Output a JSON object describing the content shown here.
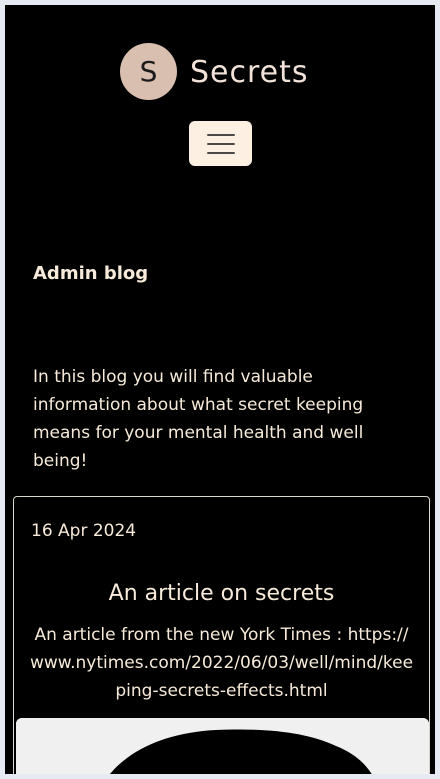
{
  "brand": {
    "logo_letter": "S",
    "name": "Secrets"
  },
  "nav": {
    "toggle_icon": "hamburger-menu-icon"
  },
  "page": {
    "title": "Admin blog",
    "intro": "In this blog you will find valuable information about what secret keeping means for your mental health and well being!"
  },
  "posts": [
    {
      "date": "16 Apr 2024",
      "title": "An article on secrets",
      "excerpt": "An article from the new York Times : https://www.nytimes.com/2022/06/03/well/mind/keeping-secrets-effects.html"
    }
  ],
  "colors": {
    "background": "#000000",
    "text": "#f7ead8",
    "logo": "#d8bfb0",
    "toggle": "#fdf0e2"
  }
}
